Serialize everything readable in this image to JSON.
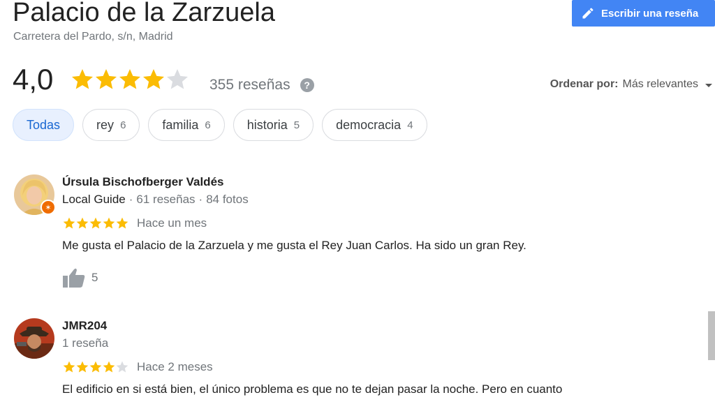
{
  "place": {
    "name": "Palacio de la Zarzuela",
    "address": "Carretera del Pardo, s/n, Madrid",
    "rating": "4,0",
    "rating_value": 4,
    "reviews_label": "355 reseñas"
  },
  "write_review": {
    "label": "Escribir una reseña"
  },
  "sort": {
    "label": "Ordenar por:",
    "value": "Más relevantes"
  },
  "filters": [
    {
      "label": "Todas",
      "count": "",
      "active": true
    },
    {
      "label": "rey",
      "count": "6"
    },
    {
      "label": "familia",
      "count": "6"
    },
    {
      "label": "historia",
      "count": "5"
    },
    {
      "label": "democracia",
      "count": "4"
    }
  ],
  "reviews": [
    {
      "name": "Úrsula Bischofberger Valdés",
      "guide": "Local Guide",
      "reviews": "61 reseñas",
      "photos": "84 fotos",
      "stars": 5,
      "date": "Hace un mes",
      "text": "Me gusta el Palacio de la Zarzuela y me gusta el Rey Juan Carlos. Ha sido un gran Rey.",
      "likes": "5"
    },
    {
      "name": "JMR204",
      "meta": "1 reseña",
      "stars": 4,
      "date": "Hace 2 meses",
      "text": "El edificio en si está bien, el único problema es que no te dejan pasar la noche. Pero en cuanto"
    }
  ],
  "colors": {
    "star_filled": "#fbbc04",
    "star_empty": "#dadce0",
    "accent": "#4285f4"
  }
}
